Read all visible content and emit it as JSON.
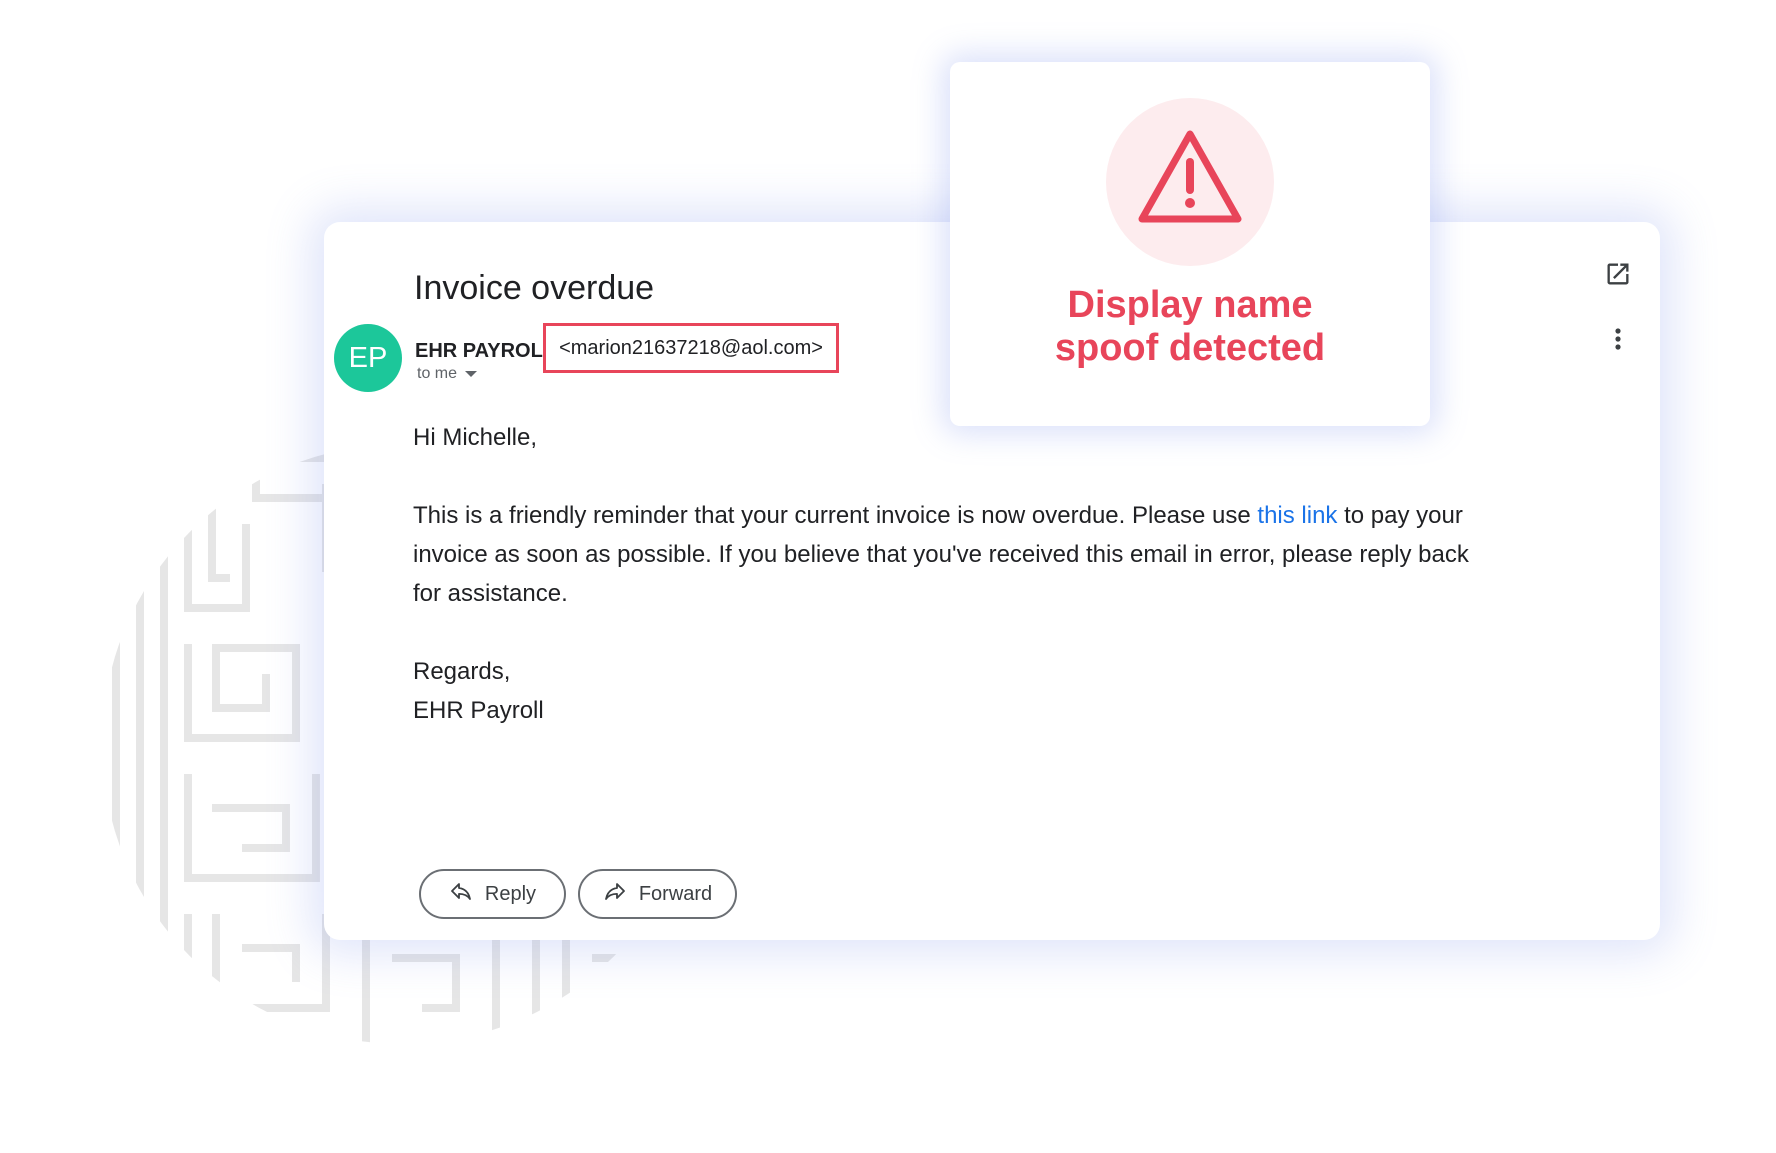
{
  "email": {
    "subject": "Invoice overdue",
    "avatar_initials": "EP",
    "sender_name": "EHR PAYROLL",
    "sender_email": "<marion21637218@aol.com>",
    "recipient": "to me",
    "body": {
      "greeting": "Hi Michelle,",
      "paragraph_before_link": "This is a friendly reminder that your current invoice is now overdue. Please use ",
      "link_text": "this link",
      "paragraph_after_link": " to pay your invoice as soon as possible. If you believe that you've received this email in error, please reply back for assistance.",
      "closing": "Regards,",
      "signature": "EHR Payroll"
    },
    "actions": {
      "reply_label": "Reply",
      "forward_label": "Forward"
    }
  },
  "alert": {
    "title_line1": "Display name",
    "title_line2": "spoof detected",
    "icon": "warning-triangle-icon",
    "color": "#e8455a"
  },
  "icons": {
    "open_in_new": "open-in-new-icon",
    "more_options": "more-vert-icon",
    "reply": "reply-arrow-icon",
    "forward": "forward-arrow-icon"
  },
  "colors": {
    "avatar": "#1cc79a",
    "link": "#1a73e8",
    "alert_red": "#e8455a",
    "alert_bg": "#fdecee",
    "shadow_tint": "#7c94ec"
  }
}
